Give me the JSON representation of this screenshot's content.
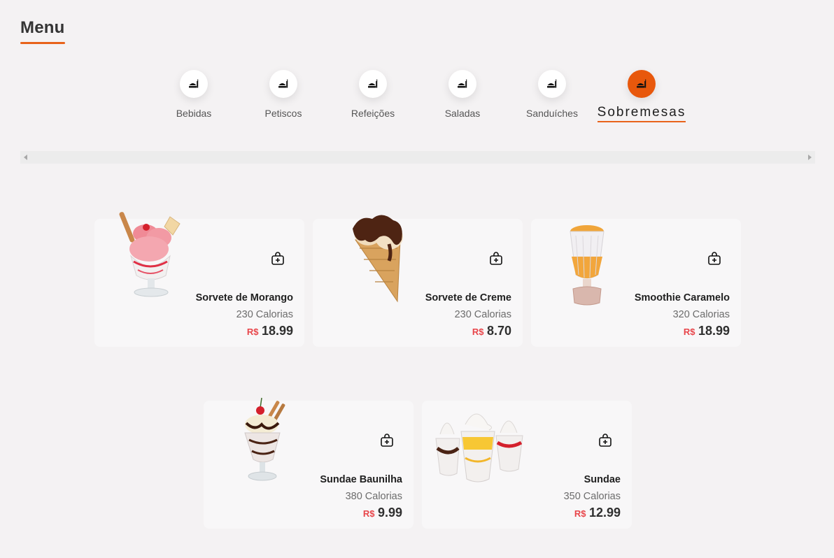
{
  "page": {
    "title": "Menu"
  },
  "categories": [
    {
      "label": "Bebidas",
      "icon": "food-icon",
      "active": false
    },
    {
      "label": "Petiscos",
      "icon": "food-icon",
      "active": false
    },
    {
      "label": "Refeições",
      "icon": "food-icon",
      "active": false
    },
    {
      "label": "Saladas",
      "icon": "food-icon",
      "active": false
    },
    {
      "label": "Sanduíches",
      "icon": "food-icon",
      "active": false
    },
    {
      "label": "Sobremesas",
      "icon": "food-icon",
      "active": true
    }
  ],
  "colors": {
    "accent": "#e8580c",
    "price_currency": "#e8454a"
  },
  "products": [
    {
      "name": "Sorvete de Morango",
      "calories": "230 Calorias",
      "currency": "R$",
      "price": "18.99",
      "image": "strawberry-sundae-image"
    },
    {
      "name": "Sorvete de Creme",
      "calories": "230 Calorias",
      "currency": "R$",
      "price": "8.70",
      "image": "chocolate-cone-image"
    },
    {
      "name": "Smoothie Caramelo",
      "calories": "320 Calorias",
      "currency": "R$",
      "price": "18.99",
      "image": "caramel-smoothie-image"
    },
    {
      "name": "Sundae Baunilha",
      "calories": "380 Calorias",
      "currency": "R$",
      "price": "9.99",
      "image": "vanilla-sundae-image"
    },
    {
      "name": "Sundae",
      "calories": "350 Calorias",
      "currency": "R$",
      "price": "12.99",
      "image": "sundae-trio-image"
    }
  ]
}
